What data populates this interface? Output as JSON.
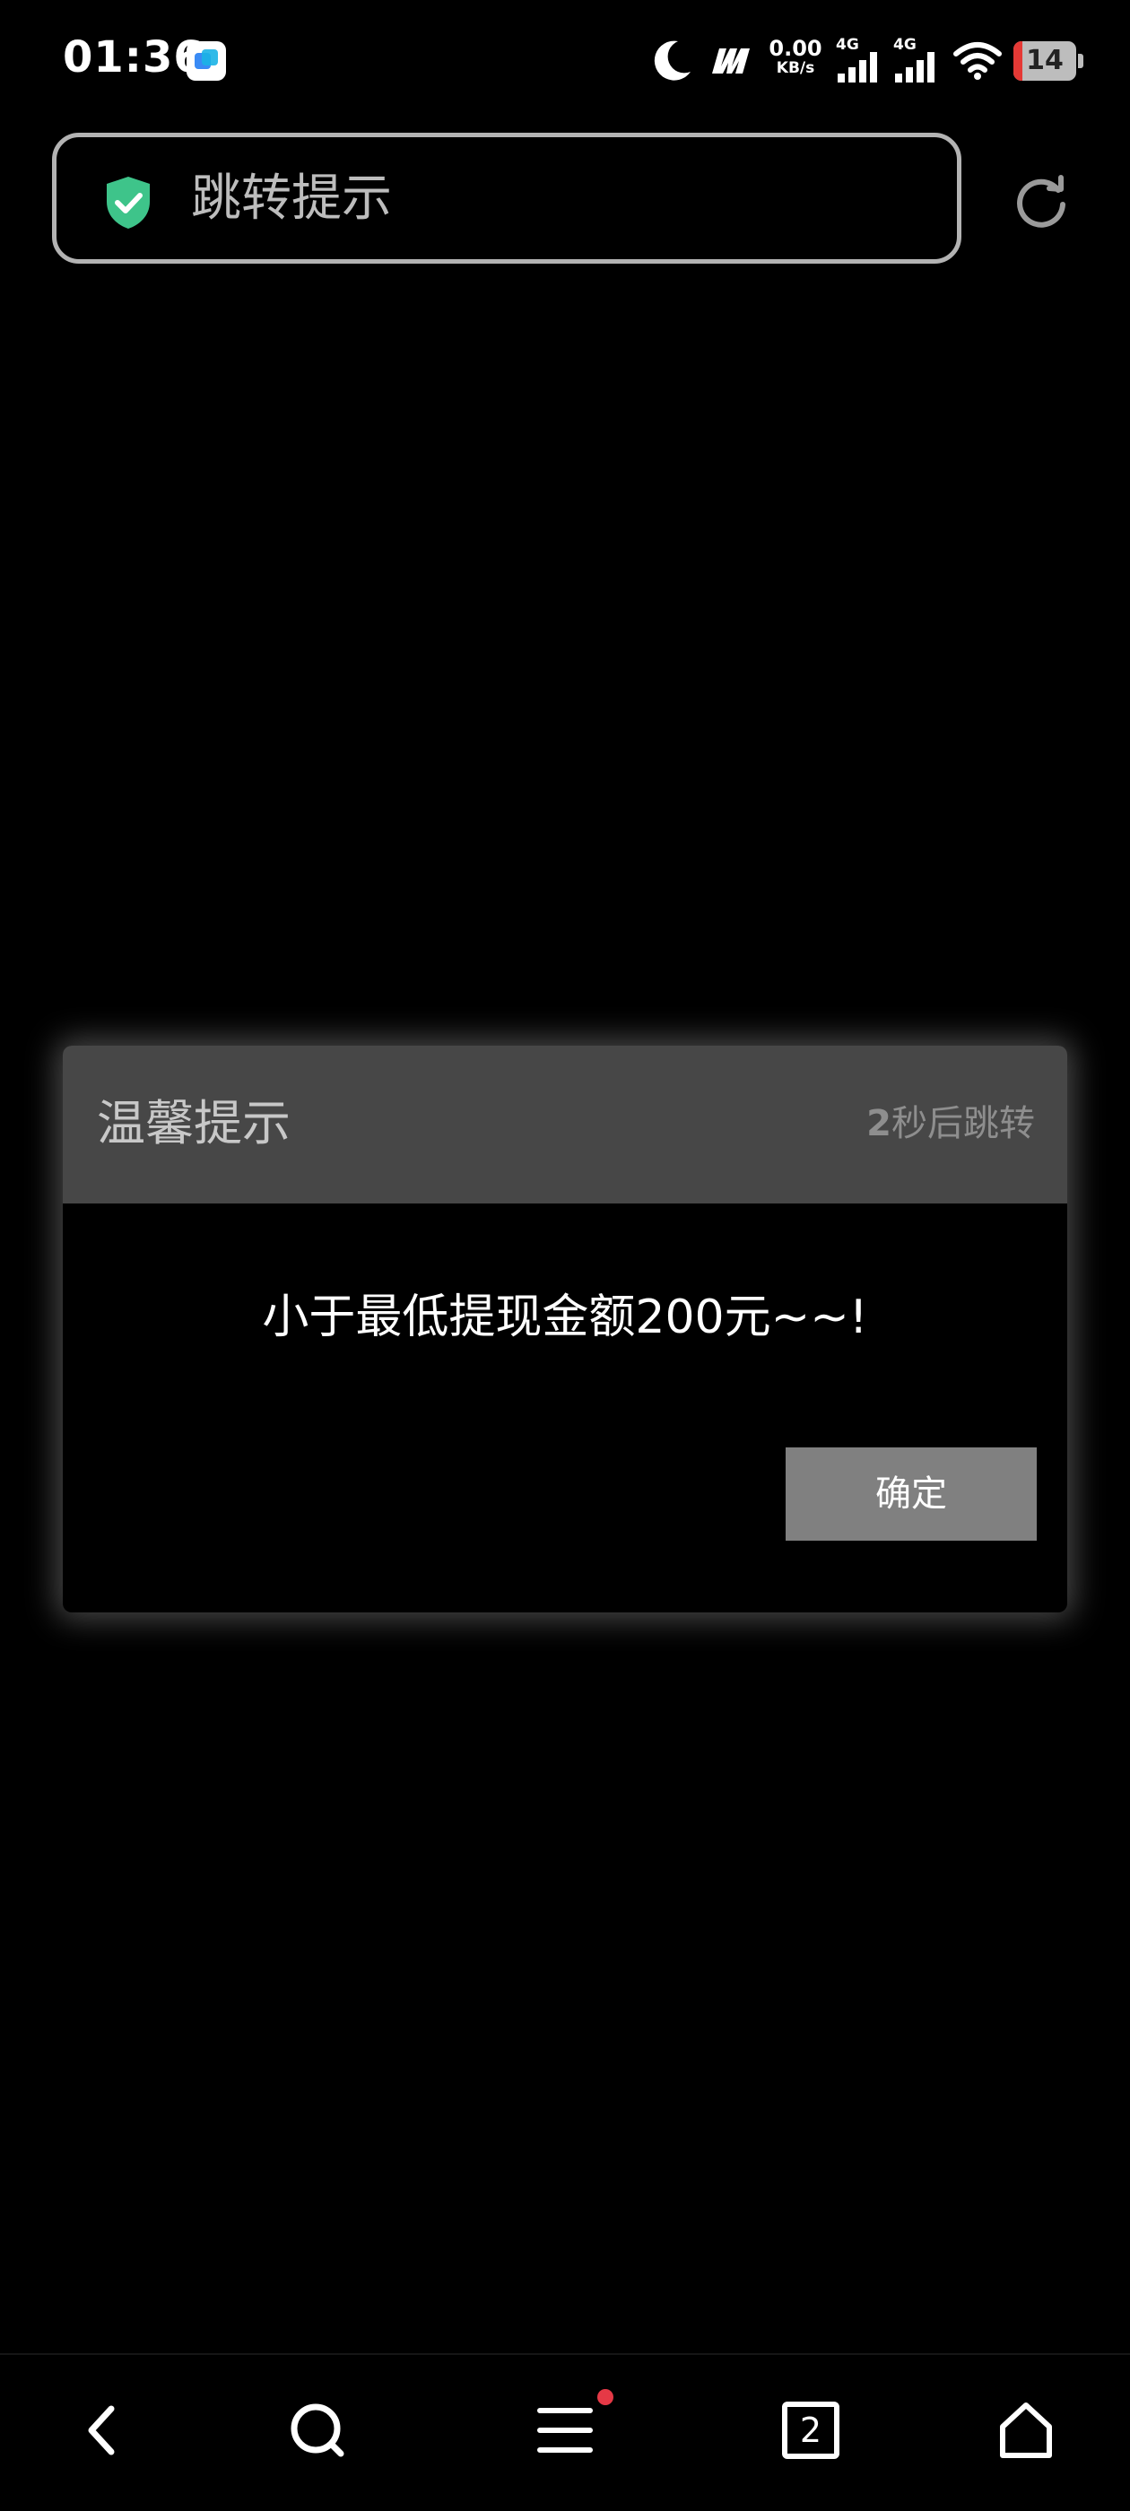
{
  "status_bar": {
    "time": "01:36",
    "net_speed_value": "0.00",
    "net_speed_unit": "KB/s",
    "signal_1_label": "4G",
    "signal_2_label": "4G",
    "battery_percent": "14",
    "battery_level": 0.14,
    "icons": [
      "app-notification-icon",
      "moon-icon",
      "hd-icon",
      "signal-icon",
      "signal-icon",
      "wifi-icon",
      "battery-icon"
    ]
  },
  "address_bar": {
    "title": "跳转提示",
    "secure_icon": "shield-check-icon",
    "refresh_icon": "refresh-icon"
  },
  "dialog": {
    "title": "温馨提示",
    "countdown_number": "2",
    "countdown_suffix": "秒后跳转",
    "message": "小于最低提现金额200元~~!",
    "confirm_label": "确定"
  },
  "bottom_nav": {
    "items": [
      {
        "name": "back",
        "icon": "chevron-left-icon"
      },
      {
        "name": "search",
        "icon": "search-icon"
      },
      {
        "name": "menu",
        "icon": "menu-icon",
        "badge": true
      },
      {
        "name": "tabs",
        "icon": "tabs-icon",
        "count": "2"
      },
      {
        "name": "home",
        "icon": "home-icon"
      }
    ]
  },
  "colors": {
    "background": "#000000",
    "dialog_header": "#474747",
    "confirm_button": "#808080",
    "secure_green": "#3ec48a",
    "badge_red": "#e53946",
    "battery_low": "#e53935"
  }
}
